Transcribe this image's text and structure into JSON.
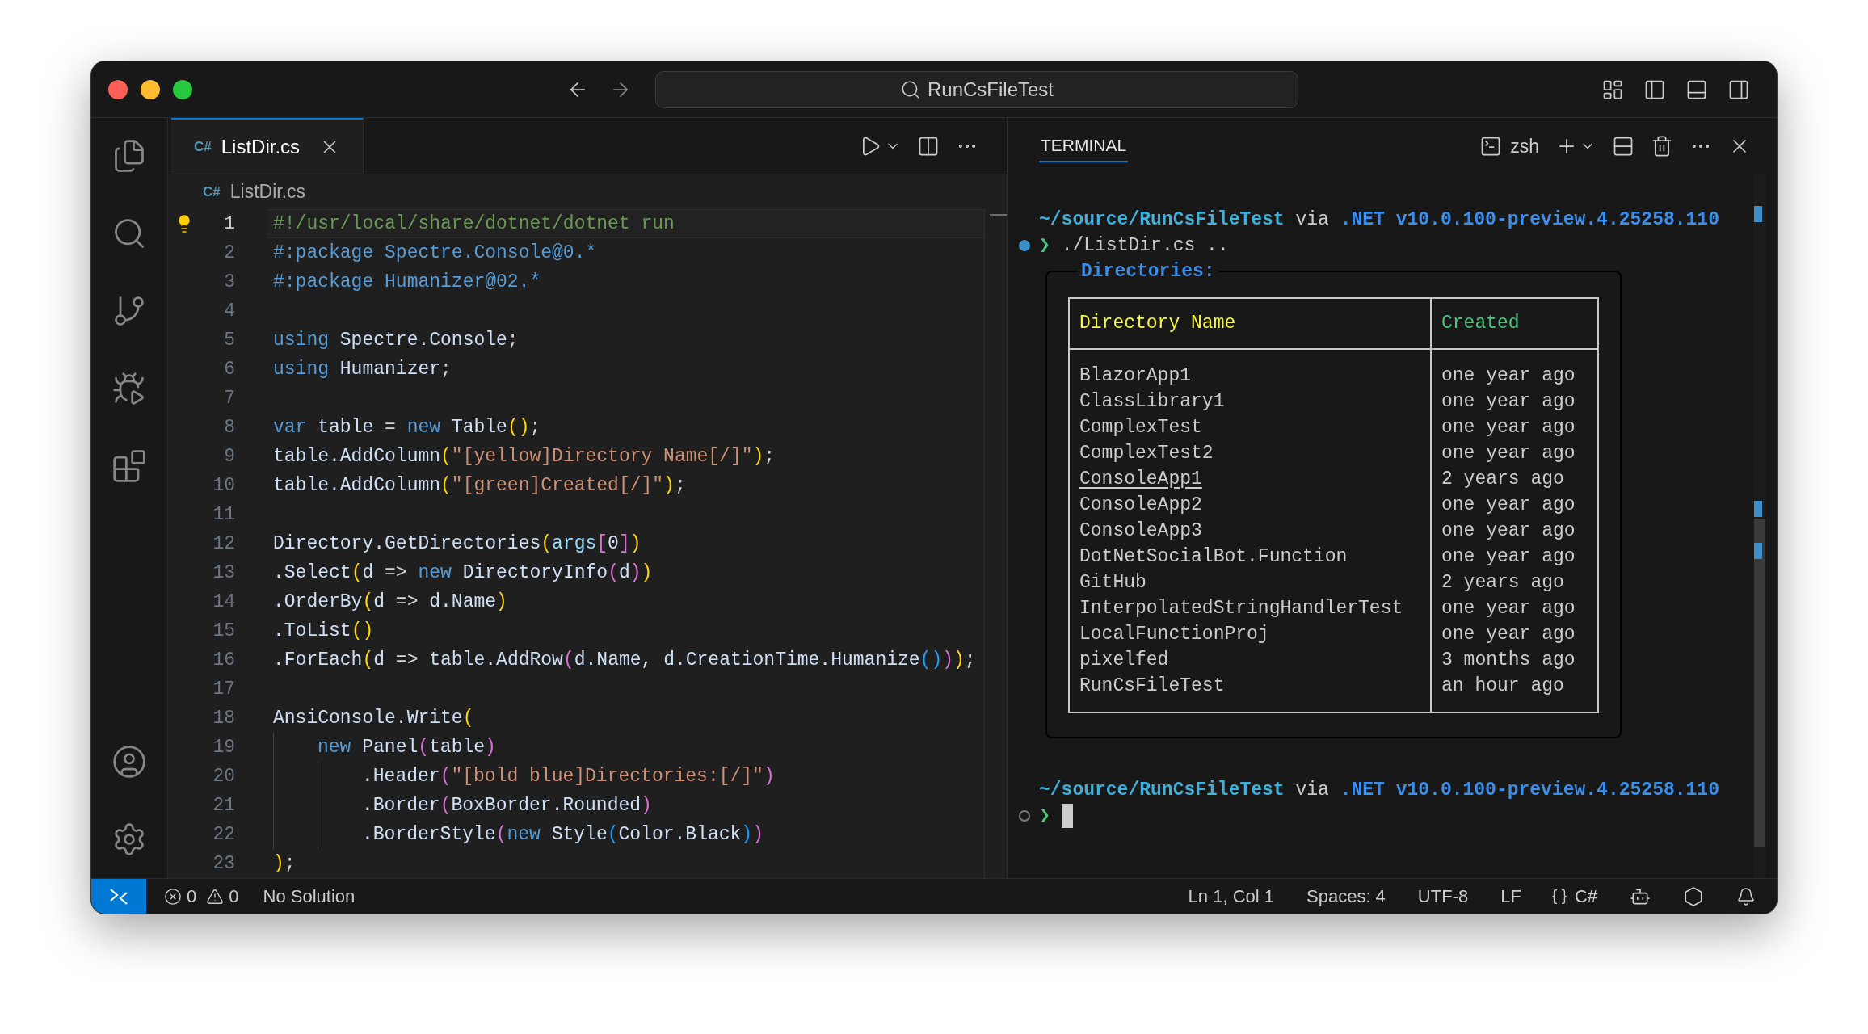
{
  "window": {
    "title": "RunCsFileTest"
  },
  "editor": {
    "tab": {
      "file_icon": "C#",
      "label": "ListDir.cs",
      "selected": true
    },
    "breadcrumb": {
      "file_icon": "C#",
      "label": "ListDir.cs"
    },
    "lines": [
      {
        "number": "1",
        "current": true,
        "tokens": [
          {
            "text": "#!/usr/local/share/dotnet/dotnet run",
            "color": "#6a9955"
          }
        ]
      },
      {
        "number": "2",
        "current": false,
        "tokens": [
          {
            "text": "#:package Spectre.Console@0.*",
            "color": "#569cd6"
          }
        ]
      },
      {
        "number": "3",
        "current": false,
        "tokens": [
          {
            "text": "#:package Humanizer@02.*",
            "color": "#569cd6"
          }
        ]
      },
      {
        "number": "4",
        "current": false
      },
      {
        "number": "5",
        "current": false,
        "tokens": [
          {
            "text": "using",
            "color": "#569cd6"
          },
          {
            "text": " Spectre.Console",
            "color": "#cfe0f5"
          },
          {
            "text": ";",
            "color": "#d4d4d4"
          }
        ]
      },
      {
        "number": "6",
        "current": false,
        "tokens": [
          {
            "text": "using",
            "color": "#569cd6"
          },
          {
            "text": " Humanizer",
            "color": "#cfe0f5"
          },
          {
            "text": ";",
            "color": "#d4d4d4"
          }
        ]
      },
      {
        "number": "7",
        "current": false
      },
      {
        "number": "8",
        "current": false,
        "tokens": [
          {
            "text": "var",
            "color": "#569cd6"
          },
          {
            "text": " table ",
            "color": "#cfe0f5"
          },
          {
            "text": "= ",
            "color": "#d4d4d4"
          },
          {
            "text": "new",
            "color": "#569cd6"
          },
          {
            "text": " Table",
            "color": "#cfe0f5"
          },
          {
            "text": "()",
            "color": "#ffd700"
          },
          {
            "text": ";",
            "color": "#d4d4d4"
          }
        ]
      },
      {
        "number": "9",
        "current": false,
        "tokens": [
          {
            "text": "table.AddColumn",
            "color": "#cfe0f5"
          },
          {
            "text": "(",
            "color": "#ffd700"
          },
          {
            "text": "\"[yellow]Directory Name[/]\"",
            "color": "#ce9178"
          },
          {
            "text": ")",
            "color": "#ffd700"
          },
          {
            "text": ";",
            "color": "#d4d4d4"
          }
        ]
      },
      {
        "number": "10",
        "current": false,
        "tokens": [
          {
            "text": "table.AddColumn",
            "color": "#cfe0f5"
          },
          {
            "text": "(",
            "color": "#ffd700"
          },
          {
            "text": "\"[green]Created[/]\"",
            "color": "#ce9178"
          },
          {
            "text": ")",
            "color": "#ffd700"
          },
          {
            "text": ";",
            "color": "#d4d4d4"
          }
        ]
      },
      {
        "number": "11",
        "current": false
      },
      {
        "number": "12",
        "current": false,
        "tokens": [
          {
            "text": "Directory.GetDirectories",
            "color": "#cfe0f5"
          },
          {
            "text": "(",
            "color": "#ffd700"
          },
          {
            "text": "args",
            "color": "#9cdcfe"
          },
          {
            "text": "[",
            "color": "#da70d6"
          },
          {
            "text": "0",
            "color": "#cfe0f5"
          },
          {
            "text": "]",
            "color": "#da70d6"
          },
          {
            "text": ")",
            "color": "#ffd700"
          }
        ]
      },
      {
        "number": "13",
        "current": false,
        "tokens": [
          {
            "text": ".Select",
            "color": "#cfe0f5"
          },
          {
            "text": "(",
            "color": "#ffd700"
          },
          {
            "text": "d ",
            "color": "#cfe0f5"
          },
          {
            "text": "=> ",
            "color": "#d4d4d4"
          },
          {
            "text": "new",
            "color": "#569cd6"
          },
          {
            "text": " DirectoryInfo",
            "color": "#cfe0f5"
          },
          {
            "text": "(",
            "color": "#da70d6"
          },
          {
            "text": "d",
            "color": "#cfe0f5"
          },
          {
            "text": ")",
            "color": "#da70d6"
          },
          {
            "text": ")",
            "color": "#ffd700"
          }
        ]
      },
      {
        "number": "14",
        "current": false,
        "tokens": [
          {
            "text": ".OrderBy",
            "color": "#cfe0f5"
          },
          {
            "text": "(",
            "color": "#ffd700"
          },
          {
            "text": "d ",
            "color": "#cfe0f5"
          },
          {
            "text": "=> ",
            "color": "#d4d4d4"
          },
          {
            "text": "d.Name",
            "color": "#cfe0f5"
          },
          {
            "text": ")",
            "color": "#ffd700"
          }
        ]
      },
      {
        "number": "15",
        "current": false,
        "tokens": [
          {
            "text": ".ToList",
            "color": "#cfe0f5"
          },
          {
            "text": "()",
            "color": "#ffd700"
          }
        ]
      },
      {
        "number": "16",
        "current": false,
        "tokens": [
          {
            "text": ".ForEach",
            "color": "#cfe0f5"
          },
          {
            "text": "(",
            "color": "#ffd700"
          },
          {
            "text": "d ",
            "color": "#cfe0f5"
          },
          {
            "text": "=> ",
            "color": "#d4d4d4"
          },
          {
            "text": "table.AddRow",
            "color": "#cfe0f5"
          },
          {
            "text": "(",
            "color": "#da70d6"
          },
          {
            "text": "d.Name, d.CreationTime.Humanize",
            "color": "#cfe0f5"
          },
          {
            "text": "()",
            "color": "#179fff"
          },
          {
            "text": ")",
            "color": "#da70d6"
          },
          {
            "text": ")",
            "color": "#ffd700"
          },
          {
            "text": ";",
            "color": "#d4d4d4"
          }
        ]
      },
      {
        "number": "17",
        "current": false
      },
      {
        "number": "18",
        "current": false,
        "tokens": [
          {
            "text": "AnsiConsole.Write",
            "color": "#cfe0f5"
          },
          {
            "text": "(",
            "color": "#ffd700"
          }
        ]
      },
      {
        "number": "19",
        "current": false,
        "kind": "argument",
        "tokens": [
          {
            "text": "new",
            "color": "#569cd6"
          },
          {
            "text": " Panel",
            "color": "#cfe0f5"
          },
          {
            "text": "(",
            "color": "#da70d6"
          },
          {
            "text": "table",
            "color": "#cfe0f5"
          },
          {
            "text": ")",
            "color": "#da70d6"
          }
        ]
      },
      {
        "number": "20",
        "current": false,
        "kind": "chained",
        "tokens": [
          {
            "text": ".Header",
            "color": "#cfe0f5"
          },
          {
            "text": "(",
            "color": "#da70d6"
          },
          {
            "text": "\"[bold blue]Directories:[/]\"",
            "color": "#ce9178"
          },
          {
            "text": ")",
            "color": "#da70d6"
          }
        ]
      },
      {
        "number": "21",
        "current": false,
        "kind": "chained",
        "tokens": [
          {
            "text": ".Border",
            "color": "#cfe0f5"
          },
          {
            "text": "(",
            "color": "#da70d6"
          },
          {
            "text": "BoxBorder.Rounded",
            "color": "#cfe0f5"
          },
          {
            "text": ")",
            "color": "#da70d6"
          }
        ]
      },
      {
        "number": "22",
        "current": false,
        "kind": "chained",
        "tokens": [
          {
            "text": ".BorderStyle",
            "color": "#cfe0f5"
          },
          {
            "text": "(",
            "color": "#da70d6"
          },
          {
            "text": "new",
            "color": "#569cd6"
          },
          {
            "text": " Style",
            "color": "#cfe0f5"
          },
          {
            "text": "(",
            "color": "#179fff"
          },
          {
            "text": "Color.Black",
            "color": "#cfe0f5"
          },
          {
            "text": ")",
            "color": "#179fff"
          },
          {
            "text": ")",
            "color": "#da70d6"
          }
        ]
      },
      {
        "number": "23",
        "current": false,
        "tokens": [
          {
            "text": ")",
            "color": "#ffd700"
          },
          {
            "text": ";",
            "color": "#d4d4d4"
          }
        ]
      }
    ]
  },
  "terminal": {
    "tab": {
      "label": "TERMINAL",
      "selected": true
    },
    "shell": "zsh",
    "runs": [
      {
        "prompt": {
          "path": "~/source/RunCsFileTest",
          "via": "via",
          "runtime": ".NET v10.0.100-preview.4.25258.110"
        },
        "symbol": "❯",
        "command": "./ListDir.cs ..",
        "finished": true,
        "output": {
          "header": "Directories:",
          "columns": [
            "Directory Name",
            "Created"
          ],
          "rows": [
            {
              "name": "BlazorApp1",
              "created": "one year ago",
              "hovered": false
            },
            {
              "name": "ClassLibrary1",
              "created": "one year ago",
              "hovered": false
            },
            {
              "name": "ComplexTest",
              "created": "one year ago",
              "hovered": false
            },
            {
              "name": "ComplexTest2",
              "created": "one year ago",
              "hovered": false
            },
            {
              "name": "ConsoleApp1",
              "created": "2 years ago",
              "hovered": true
            },
            {
              "name": "ConsoleApp2",
              "created": "one year ago",
              "hovered": false
            },
            {
              "name": "ConsoleApp3",
              "created": "one year ago",
              "hovered": false
            },
            {
              "name": "DotNetSocialBot.Function",
              "created": "one year ago",
              "hovered": false
            },
            {
              "name": "GitHub",
              "created": "2 years ago",
              "hovered": false
            },
            {
              "name": "InterpolatedStringHandlerTest",
              "created": "one year ago",
              "hovered": false
            },
            {
              "name": "LocalFunctionProj",
              "created": "one year ago",
              "hovered": false
            },
            {
              "name": "pixelfed",
              "created": "3 months ago",
              "hovered": false
            },
            {
              "name": "RunCsFileTest",
              "created": "an hour ago",
              "hovered": false
            }
          ]
        }
      },
      {
        "prompt": {
          "path": "~/source/RunCsFileTest",
          "via": "via",
          "runtime": ".NET v10.0.100-preview.4.25258.110"
        },
        "symbol": "❯",
        "finished": false,
        "cursor": true
      }
    ]
  },
  "status_bar": {
    "errors": "0",
    "warnings": "0",
    "solution": "No Solution",
    "position": "Ln 1, Col 1",
    "spaces": "Spaces: 4",
    "encoding": "UTF-8",
    "eol": "LF",
    "language": "C#"
  }
}
